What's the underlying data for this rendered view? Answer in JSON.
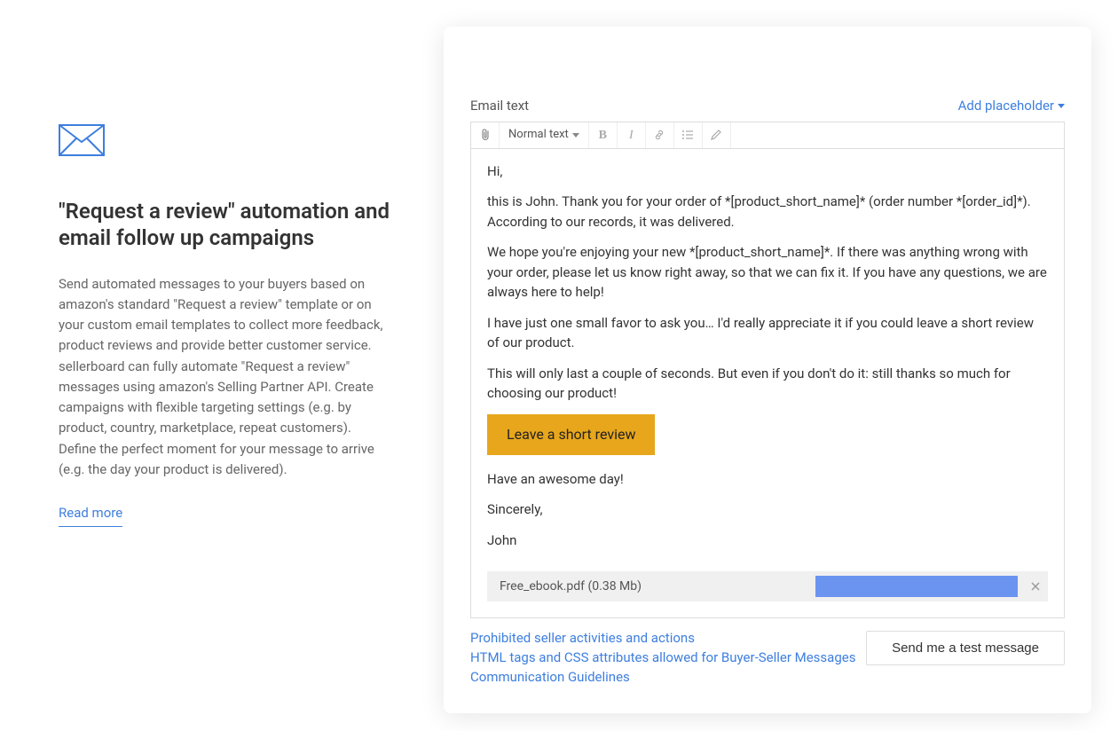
{
  "left": {
    "title": "\"Request a review\" automation and email follow up campaigns",
    "body": "Send automated messages to your buyers based on amazon's standard \"Request a review\" template or on your custom email templates to collect more feedback, product reviews and provide better customer service. sellerboard can fully automate \"Request a review\" messages using amazon's Selling Partner API. Create campaigns with flexible targeting settings (e.g. by product, country, marketplace, repeat customers). Define the perfect moment for your message to arrive (e.g. the day your product is delivered).",
    "read_more": "Read more"
  },
  "panel": {
    "label": "Email text",
    "add_placeholder": "Add placeholder",
    "toolbar": {
      "text_style": "Normal text"
    },
    "body": {
      "p1": "Hi,",
      "p2": "this is John. Thank you for your order of *[product_short_name]* (order number *[order_id]*). According to our records, it was delivered.",
      "p3": "We hope you're enjoying your new *[product_short_name]*. If there was anything wrong with your order, please let us know right away, so that we can fix it. If you have any questions, we are always here to help!",
      "p4": "I have just one small favor to ask you… I'd really appreciate it if you could leave a short review of our product.",
      "p5": "This will only last a couple of seconds. But even if you don't do it: still thanks so much for choosing our product!",
      "review_btn": "Leave a short review",
      "p6": "Have an awesome day!",
      "p7": "Sincerely,",
      "p8": "John"
    },
    "attachment": {
      "name": "Free_ebook.pdf (0.38 Mb)"
    },
    "links": {
      "l1": "Prohibited seller activities and actions",
      "l2": "HTML tags and CSS attributes allowed for Buyer-Seller Messages",
      "l3": "Communication Guidelines"
    },
    "test_btn": "Send me a test message"
  }
}
